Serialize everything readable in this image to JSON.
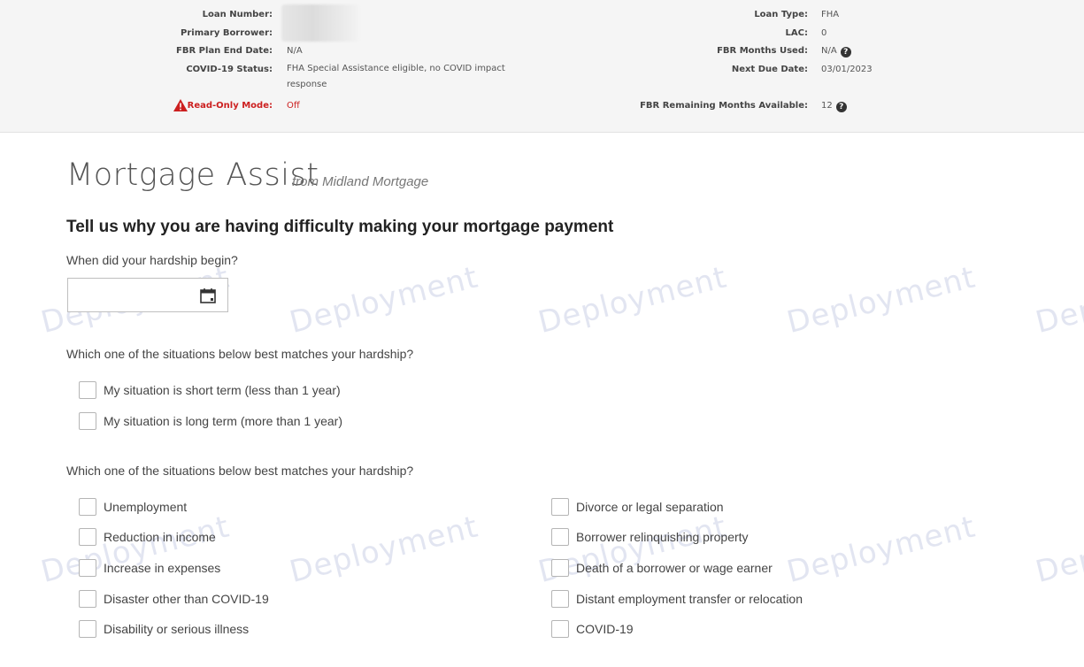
{
  "loan_info": {
    "loan_number_label": "Loan Number:",
    "primary_borrower_label": "Primary Borrower:",
    "fbr_plan_end_label": "FBR Plan End Date:",
    "fbr_plan_end_value": "N/A",
    "covid_status_label": "COVID-19 Status:",
    "covid_status_value": "FHA Special Assistance eligible, no COVID impact response",
    "read_only_label": "Read-Only Mode:",
    "read_only_value": "Off",
    "loan_type_label": "Loan Type:",
    "loan_type_value": "FHA",
    "lac_label": "LAC:",
    "lac_value": "0",
    "fbr_months_used_label": "FBR Months Used:",
    "fbr_months_used_value": "N/A",
    "next_due_label": "Next Due Date:",
    "next_due_value": "03/01/2023",
    "fbr_remaining_label": "FBR Remaining Months Available:",
    "fbr_remaining_value": "12",
    "help_glyph": "?"
  },
  "watermark": "Deployment",
  "app": {
    "title": "Mortgage Assist",
    "subtitle": "from Midland Mortgage"
  },
  "form": {
    "heading": "Tell us why you are having difficulty making your mortgage payment",
    "q_start": "When did your hardship begin?",
    "date_value": "",
    "q_duration": "Which one of the situations below best matches your hardship?",
    "duration_options": [
      "My situation is short term (less than 1 year)",
      "My situation is long term (more than 1 year)"
    ],
    "q_reason": "Which one of the situations below best matches your hardship?",
    "reasons_left": [
      "Unemployment",
      "Reduction in income",
      "Increase in expenses",
      "Disaster other than COVID-19",
      "Disability or serious illness"
    ],
    "reasons_right": [
      "Divorce or legal separation",
      "Borrower relinquishing property",
      "Death of a borrower or wage earner",
      "Distant employment transfer or relocation",
      "COVID-19"
    ]
  },
  "colors": {
    "header_bg": "#f5f5f5",
    "warning_red": "#cc1f1f"
  }
}
